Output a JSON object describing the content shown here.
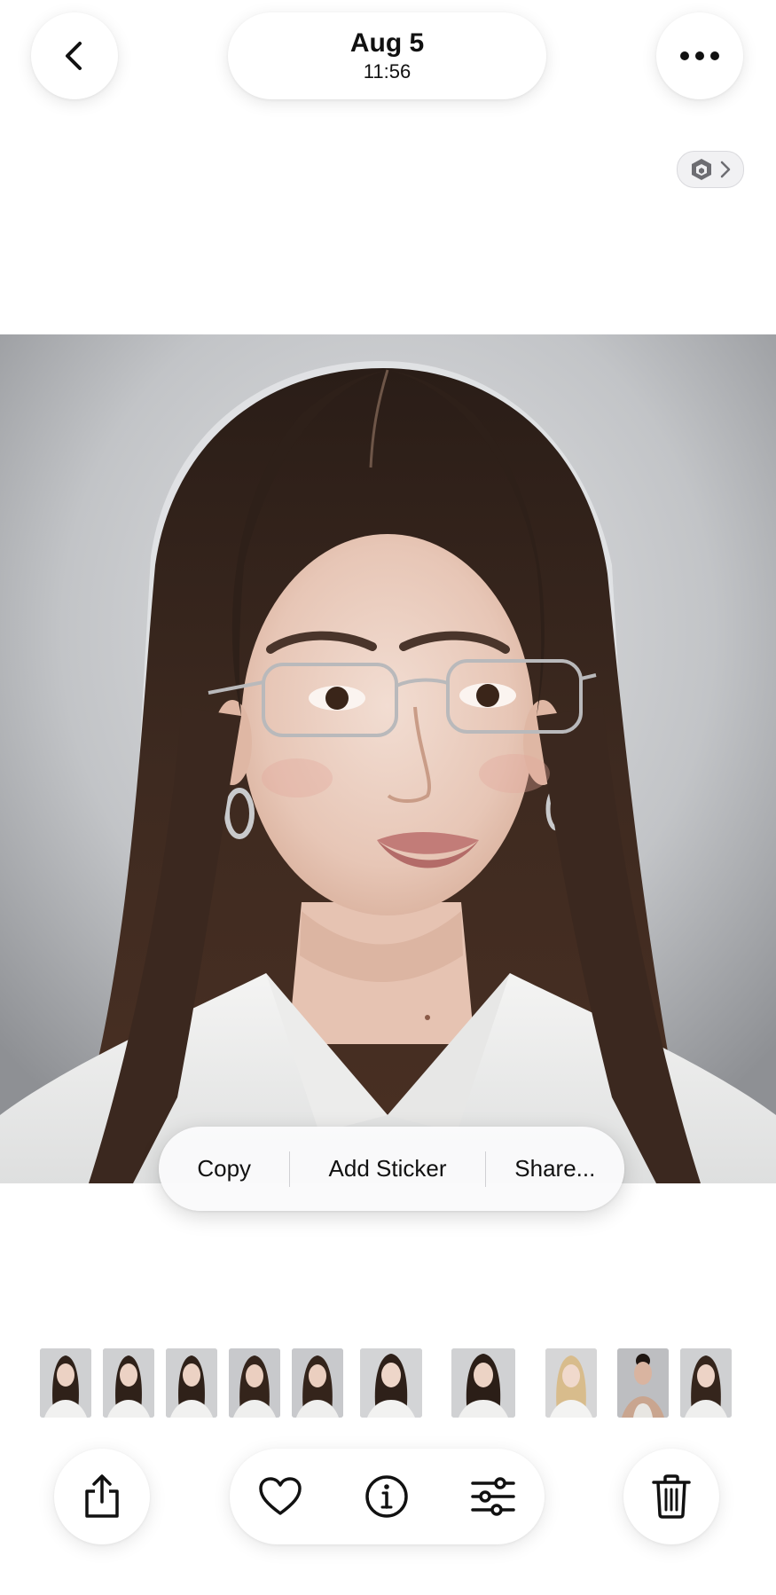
{
  "header": {
    "date": "Aug 5",
    "time": "11:56",
    "back_icon": "chevron-left-icon",
    "more_icon": "ellipsis-icon",
    "live_badge_icon": "visual-lookup-icon"
  },
  "context_menu": {
    "items": [
      "Copy",
      "Add Sticker",
      "Share..."
    ]
  },
  "thumbnails": {
    "count": 10,
    "variants": [
      "brunette",
      "brunette",
      "brunette",
      "brunette",
      "brunette",
      "brunette",
      "brunette",
      "blonde",
      "dark-updo",
      "brunette"
    ]
  },
  "toolbar": {
    "share_icon": "share-icon",
    "favorite_icon": "heart-icon",
    "info_icon": "info-icon",
    "adjust_icon": "sliders-icon",
    "delete_icon": "trash-icon"
  },
  "colors": {
    "background": "#ffffff",
    "icon": "#111111",
    "photo_backdrop": "#bfc1c4",
    "hair": "#3a2820"
  }
}
